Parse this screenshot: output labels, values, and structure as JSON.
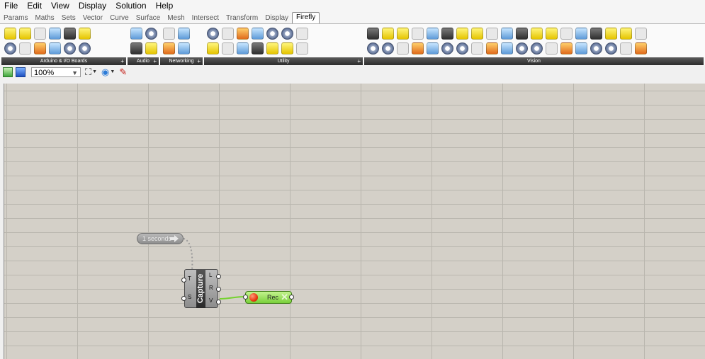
{
  "menu": [
    "File",
    "Edit",
    "View",
    "Display",
    "Solution",
    "Help"
  ],
  "tabs": [
    "Params",
    "Maths",
    "Sets",
    "Vector",
    "Curve",
    "Surface",
    "Mesh",
    "Intersect",
    "Transform",
    "Display",
    "Firefly"
  ],
  "active_tab": "Firefly",
  "ribbon_groups": [
    {
      "label": "Arduino & I/O Boards",
      "icon_count": 12
    },
    {
      "label": "Audio",
      "icon_count": 4
    },
    {
      "label": "Networking",
      "icon_count": 4
    },
    {
      "label": "Utility",
      "icon_count": 14
    },
    {
      "label": "Vision",
      "icon_count": 38
    }
  ],
  "toolbar": {
    "zoom": "100%",
    "icons": [
      "open-file-icon",
      "save-file-icon",
      "zoom-extents-icon",
      "preview-eye-icon",
      "sketch-pen-icon"
    ]
  },
  "canvas": {
    "timer": {
      "label": "1 seconds"
    },
    "capture": {
      "title": "Capture",
      "inputs": [
        "T",
        "S"
      ],
      "outputs": [
        "L",
        "R",
        "V"
      ]
    },
    "rec": {
      "label": "Rec"
    }
  },
  "colors": {
    "canvas_bg": "#d4d0c8",
    "grid_line": "#b9b6ae",
    "rec_green": "#79d03a",
    "group_label_bg": "#2c2c2c"
  }
}
